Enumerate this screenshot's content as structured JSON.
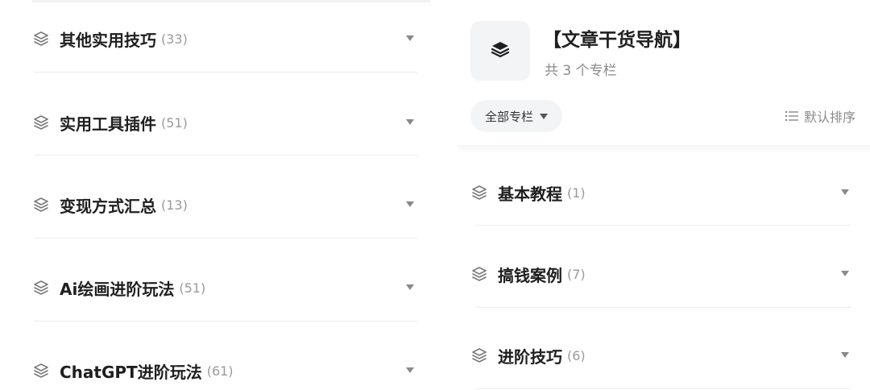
{
  "left_list": {
    "items": [
      {
        "title": "其他实用技巧",
        "count": "(33)"
      },
      {
        "title": "实用工具插件",
        "count": "(51)"
      },
      {
        "title": "变现方式汇总",
        "count": "(13)"
      },
      {
        "title": "Ai绘画进阶玩法",
        "count": "(51)"
      },
      {
        "title": "ChatGPT进阶玩法",
        "count": "(61)"
      }
    ]
  },
  "header": {
    "title": "【文章干货导航】",
    "subtitle": "共 3 个专栏",
    "icon": "layers-icon"
  },
  "filter": {
    "label": "全部专栏"
  },
  "sort": {
    "label": "默认排序",
    "icon": "list-icon"
  },
  "right_list": {
    "items": [
      {
        "title": "基本教程",
        "count": "(1)"
      },
      {
        "title": "搞钱案例",
        "count": "(7)"
      },
      {
        "title": "进阶技巧",
        "count": "(6)"
      }
    ]
  },
  "colors": {
    "text_primary": "#1f1f1f",
    "text_secondary": "#9a9a9a",
    "divider": "#ececec",
    "pill_bg": "#f3f4f6",
    "caret": "#8a8a8a"
  }
}
